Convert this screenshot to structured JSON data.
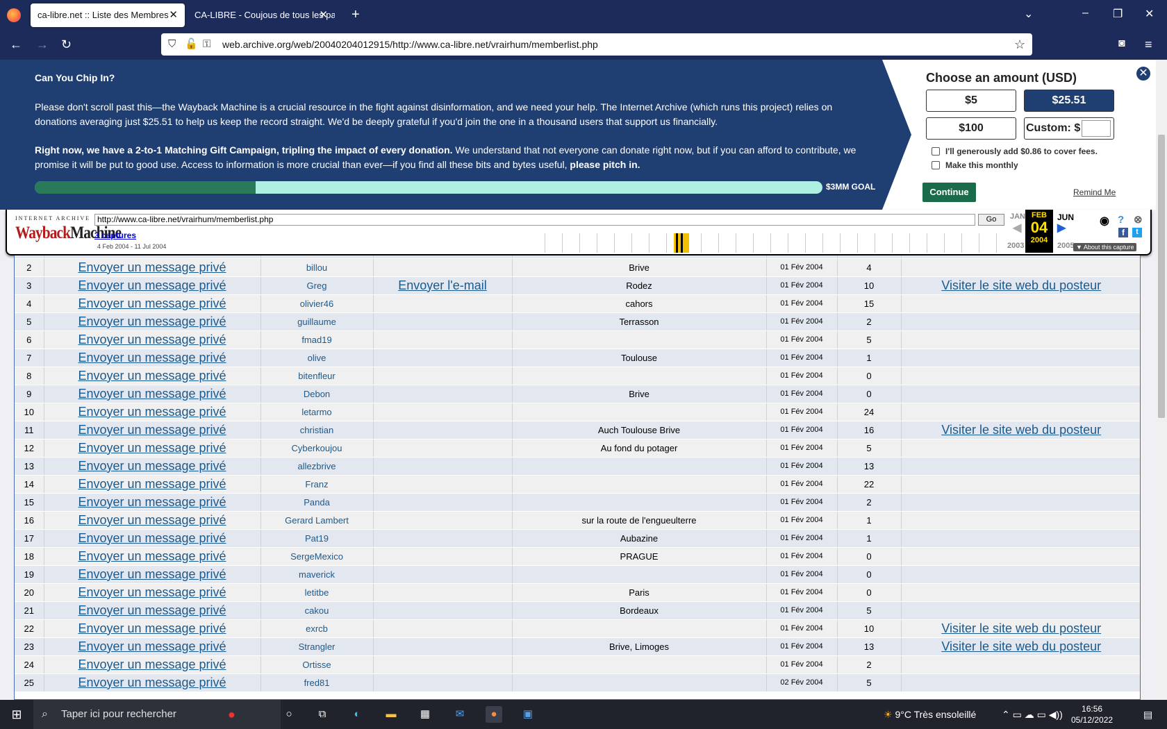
{
  "browser": {
    "tabs": [
      {
        "title": "ca-libre.net :: Liste des Membres"
      },
      {
        "title": "CA-LIBRE - Coujous de tous les pays"
      }
    ],
    "url": "web.archive.org/web/20040204012915/http://www.ca-libre.net/vrairhum/memberlist.php"
  },
  "donation": {
    "title": "Can You Chip In?",
    "p1": "Please don't scroll past this—the Wayback Machine is a crucial resource in the fight against disinformation, and we need your help. The Internet Archive (which runs this project) relies on donations averaging just $25.51 to help us keep the record straight. We'd be deeply grateful if you'd join the one in a thousand users that support us financially.",
    "p2_bold": "Right now, we have a 2-to-1 Matching Gift Campaign, tripling the impact of every donation.",
    "p2_rest": " We understand that not everyone can donate right now, but if you can afford to contribute, we promise it will be put to good use. Access to information is more crucial than ever—if you find all these bits and bytes useful, ",
    "p2_end": "please pitch in.",
    "progress_fraction": 0.28,
    "goal_label": "$3MM GOAL",
    "choose_label": "Choose an amount (USD)",
    "amounts": [
      "$5",
      "$25.51",
      "$100",
      "Custom: $"
    ],
    "cover_fees": "I'll generously add $0.86 to cover fees.",
    "monthly": "Make this monthly",
    "continue": "Continue",
    "remind": "Remind Me"
  },
  "wayback": {
    "ia_label": "INTERNET ARCHIVE",
    "logo_a": "Wayback",
    "logo_b": "Machine",
    "url": "http://www.ca-libre.net/vrairhum/memberlist.php",
    "go": "Go",
    "captures": "3 captures",
    "range": "4 Feb 2004 - 11 Jul 2004",
    "prev_month": "JAN",
    "cur_month": "FEB",
    "next_month": "JUN",
    "cur_day": "04",
    "prev_year": "2003",
    "cur_year": "2004",
    "next_year": "2005",
    "about": "About this capture"
  },
  "members": [
    {
      "n": "2",
      "pm": "Envoyer un message privé",
      "user": "billou",
      "email": "",
      "loc": "Brive",
      "date": "01 Fév 2004",
      "posts": "4",
      "web": ""
    },
    {
      "n": "3",
      "pm": "Envoyer un message privé",
      "user": "Greg",
      "email": "Envoyer l'e-mail",
      "loc": "Rodez",
      "date": "01 Fév 2004",
      "posts": "10",
      "web": "Visiter le site web du posteur"
    },
    {
      "n": "4",
      "pm": "Envoyer un message privé",
      "user": "olivier46",
      "email": "",
      "loc": "cahors",
      "date": "01 Fév 2004",
      "posts": "15",
      "web": ""
    },
    {
      "n": "5",
      "pm": "Envoyer un message privé",
      "user": "guillaume",
      "email": "",
      "loc": "Terrasson",
      "date": "01 Fév 2004",
      "posts": "2",
      "web": ""
    },
    {
      "n": "6",
      "pm": "Envoyer un message privé",
      "user": "fmad19",
      "email": "",
      "loc": "",
      "date": "01 Fév 2004",
      "posts": "5",
      "web": ""
    },
    {
      "n": "7",
      "pm": "Envoyer un message privé",
      "user": "olive",
      "email": "",
      "loc": "Toulouse",
      "date": "01 Fév 2004",
      "posts": "1",
      "web": ""
    },
    {
      "n": "8",
      "pm": "Envoyer un message privé",
      "user": "bitenfleur",
      "email": "",
      "loc": "",
      "date": "01 Fév 2004",
      "posts": "0",
      "web": ""
    },
    {
      "n": "9",
      "pm": "Envoyer un message privé",
      "user": "Debon",
      "email": "",
      "loc": "Brive",
      "date": "01 Fév 2004",
      "posts": "0",
      "web": ""
    },
    {
      "n": "10",
      "pm": "Envoyer un message privé",
      "user": "letarmo",
      "email": "",
      "loc": "",
      "date": "01 Fév 2004",
      "posts": "24",
      "web": ""
    },
    {
      "n": "11",
      "pm": "Envoyer un message privé",
      "user": "christian",
      "email": "",
      "loc": "Auch Toulouse Brive",
      "date": "01 Fév 2004",
      "posts": "16",
      "web": "Visiter le site web du posteur"
    },
    {
      "n": "12",
      "pm": "Envoyer un message privé",
      "user": "Cyberkoujou",
      "email": "",
      "loc": "Au fond du potager",
      "date": "01 Fév 2004",
      "posts": "5",
      "web": ""
    },
    {
      "n": "13",
      "pm": "Envoyer un message privé",
      "user": "allezbrive",
      "email": "",
      "loc": "",
      "date": "01 Fév 2004",
      "posts": "13",
      "web": ""
    },
    {
      "n": "14",
      "pm": "Envoyer un message privé",
      "user": "Franz",
      "email": "",
      "loc": "",
      "date": "01 Fév 2004",
      "posts": "22",
      "web": ""
    },
    {
      "n": "15",
      "pm": "Envoyer un message privé",
      "user": "Panda",
      "email": "",
      "loc": "",
      "date": "01 Fév 2004",
      "posts": "2",
      "web": ""
    },
    {
      "n": "16",
      "pm": "Envoyer un message privé",
      "user": "Gerard Lambert",
      "email": "",
      "loc": "sur la route de l'engueulterre",
      "date": "01 Fév 2004",
      "posts": "1",
      "web": ""
    },
    {
      "n": "17",
      "pm": "Envoyer un message privé",
      "user": "Pat19",
      "email": "",
      "loc": "Aubazine",
      "date": "01 Fév 2004",
      "posts": "1",
      "web": ""
    },
    {
      "n": "18",
      "pm": "Envoyer un message privé",
      "user": "SergeMexico",
      "email": "",
      "loc": "PRAGUE",
      "date": "01 Fév 2004",
      "posts": "0",
      "web": ""
    },
    {
      "n": "19",
      "pm": "Envoyer un message privé",
      "user": "maverick",
      "email": "",
      "loc": "",
      "date": "01 Fév 2004",
      "posts": "0",
      "web": ""
    },
    {
      "n": "20",
      "pm": "Envoyer un message privé",
      "user": "letitbe",
      "email": "",
      "loc": "Paris",
      "date": "01 Fév 2004",
      "posts": "0",
      "web": ""
    },
    {
      "n": "21",
      "pm": "Envoyer un message privé",
      "user": "cakou",
      "email": "",
      "loc": "Bordeaux",
      "date": "01 Fév 2004",
      "posts": "5",
      "web": ""
    },
    {
      "n": "22",
      "pm": "Envoyer un message privé",
      "user": "exrcb",
      "email": "",
      "loc": "",
      "date": "01 Fév 2004",
      "posts": "10",
      "web": "Visiter le site web du posteur"
    },
    {
      "n": "23",
      "pm": "Envoyer un message privé",
      "user": "Strangler",
      "email": "",
      "loc": "Brive, Limoges",
      "date": "01 Fév 2004",
      "posts": "13",
      "web": "Visiter le site web du posteur"
    },
    {
      "n": "24",
      "pm": "Envoyer un message privé",
      "user": "Ortisse",
      "email": "",
      "loc": "",
      "date": "01 Fév 2004",
      "posts": "2",
      "web": ""
    },
    {
      "n": "25",
      "pm": "Envoyer un message privé",
      "user": "fred81",
      "email": "",
      "loc": "",
      "date": "02 Fév 2004",
      "posts": "5",
      "web": ""
    }
  ],
  "taskbar": {
    "search_placeholder": "Taper ici pour rechercher",
    "weather": "9°C  Très ensoleillé",
    "time": "16:56",
    "date": "05/12/2022"
  }
}
